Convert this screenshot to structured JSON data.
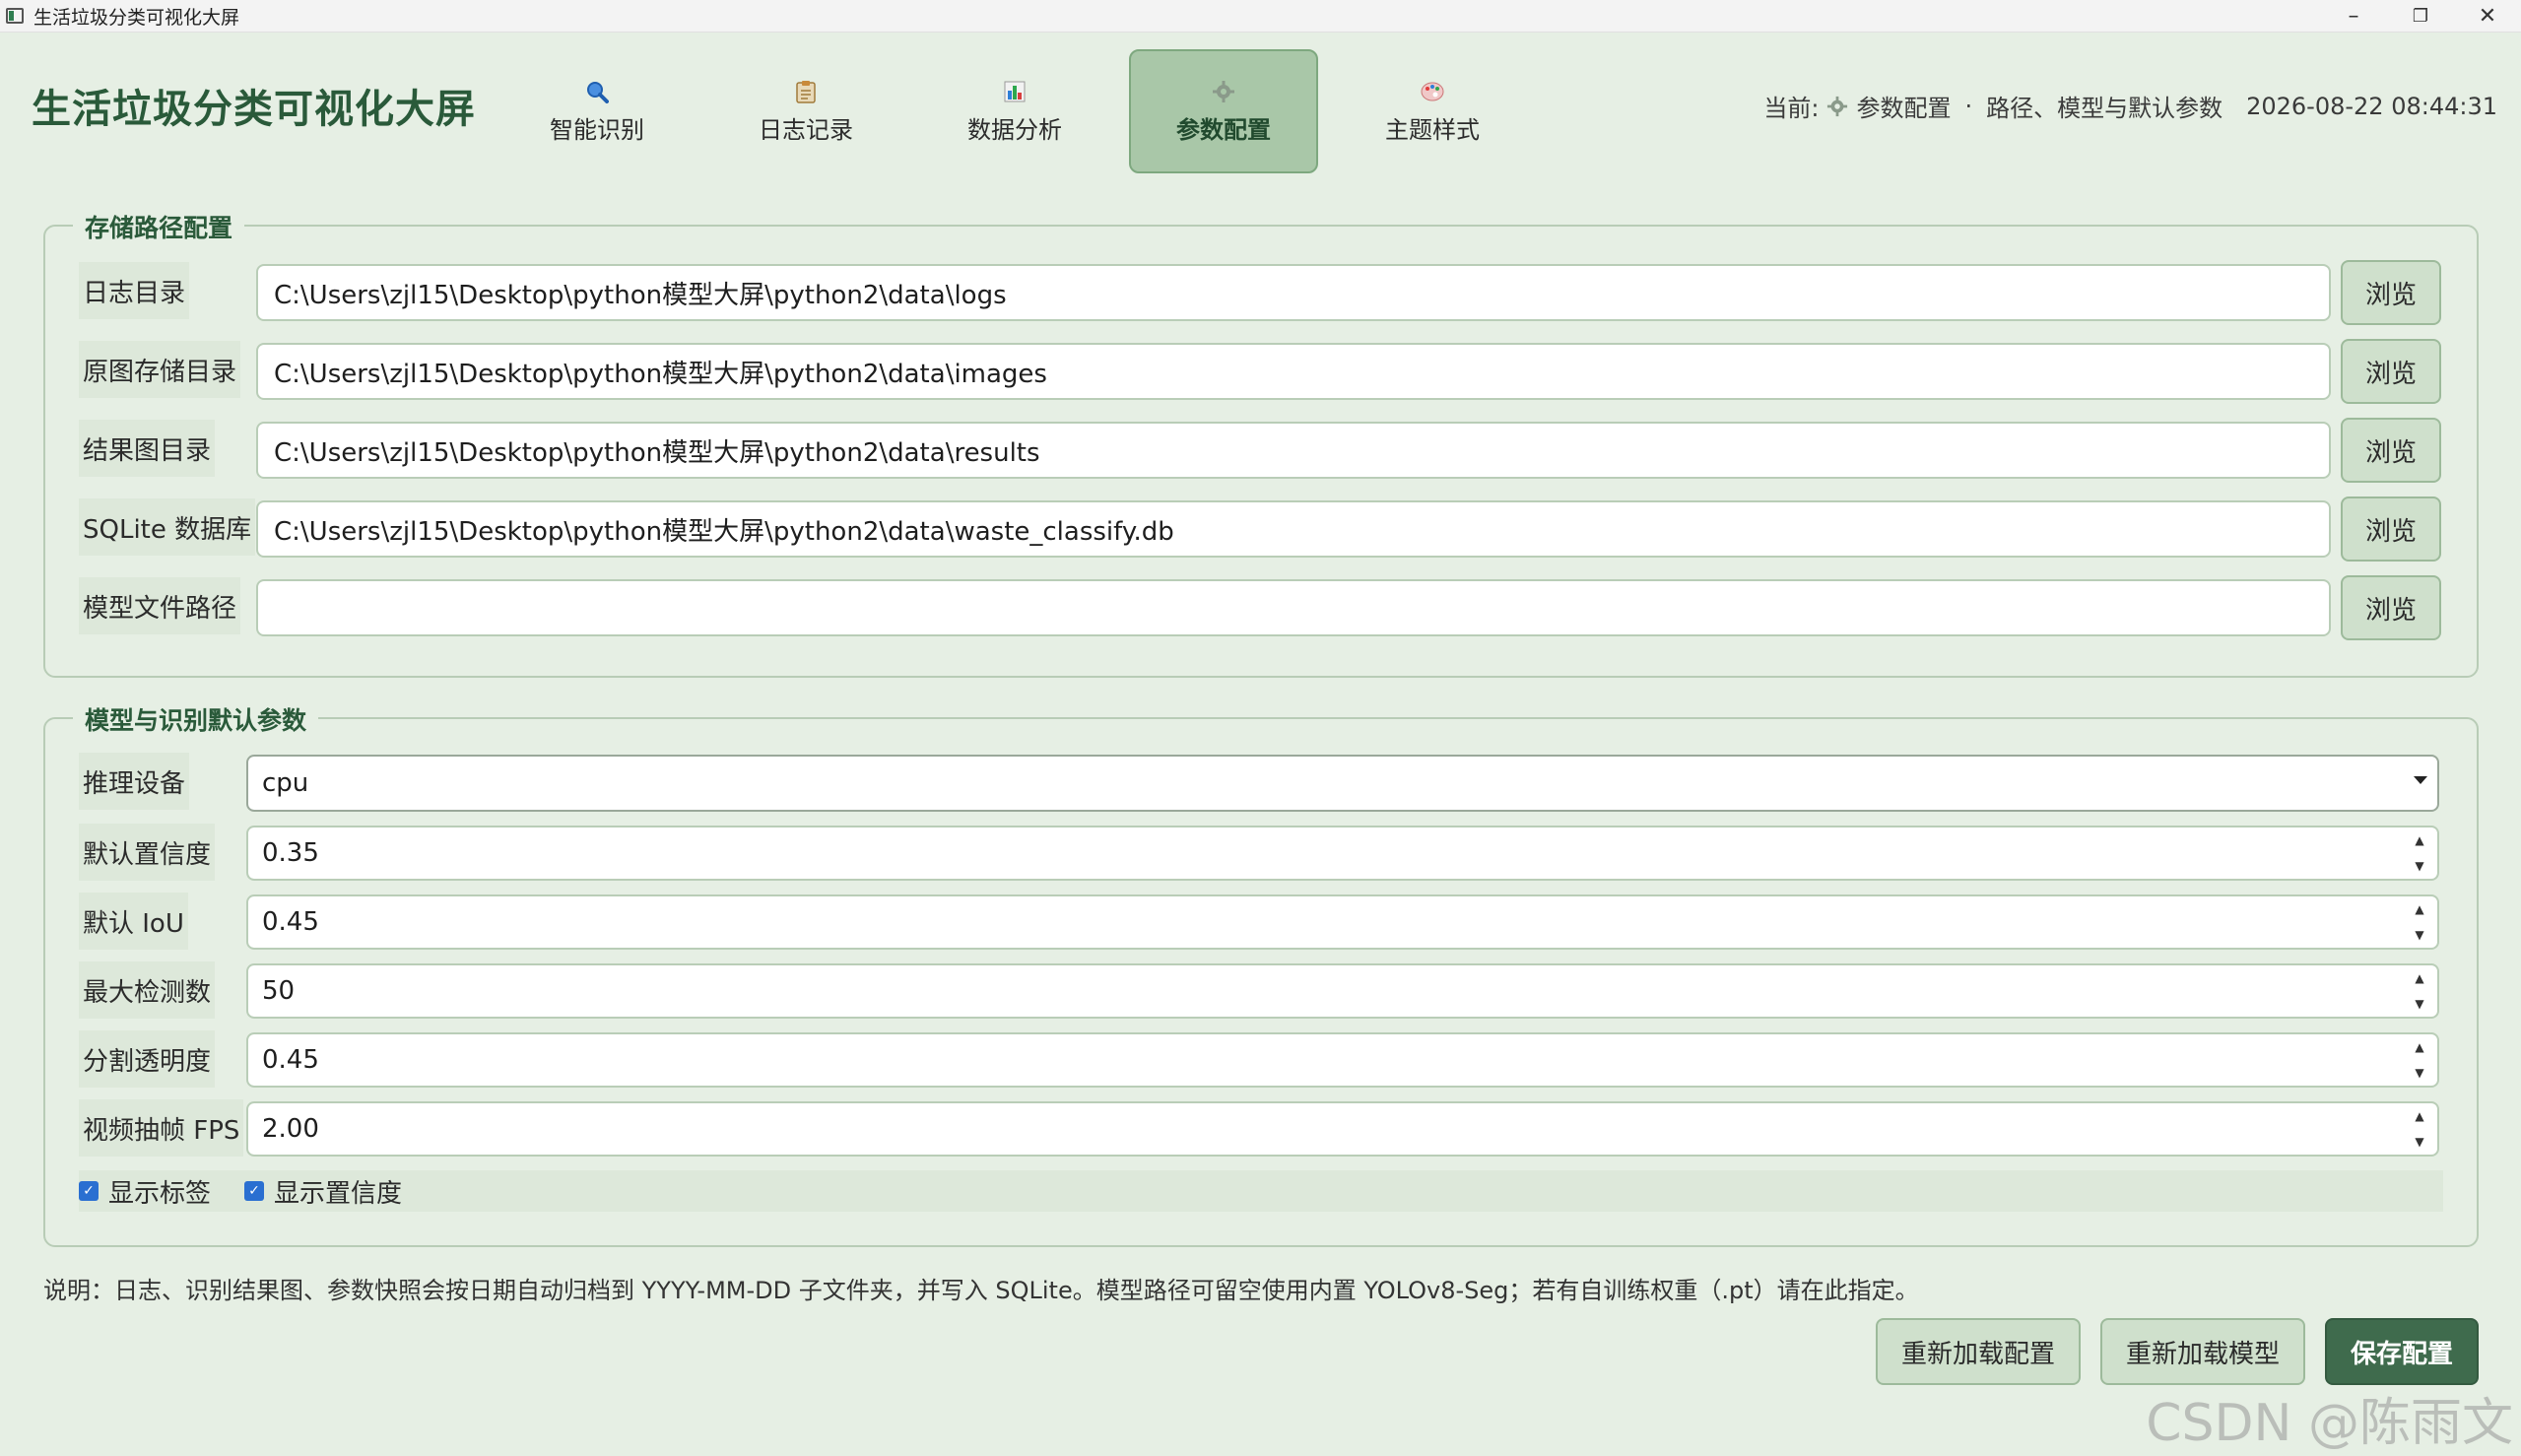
{
  "window": {
    "title": "生活垃圾分类可视化大屏",
    "minimize": "–",
    "restore": "❐",
    "close": "✕"
  },
  "header": {
    "app_title": "生活垃圾分类可视化大屏",
    "tabs": [
      {
        "label": "智能识别",
        "icon": "magnifier-icon"
      },
      {
        "label": "日志记录",
        "icon": "clipboard-icon"
      },
      {
        "label": "数据分析",
        "icon": "bar-chart-icon"
      },
      {
        "label": "参数配置",
        "icon": "gear-icon",
        "active": true
      },
      {
        "label": "主题样式",
        "icon": "palette-icon"
      }
    ],
    "status": {
      "prefix": "当前:",
      "page": "参数配置",
      "separator": "·",
      "description": "路径、模型与默认参数",
      "datetime": "2026-08-22 08:44:31"
    }
  },
  "storage": {
    "title": "存储路径配置",
    "browse_label": "浏览",
    "rows": [
      {
        "label": "日志目录",
        "value": "C:\\Users\\zjl15\\Desktop\\python模型大屏\\python2\\data\\logs"
      },
      {
        "label": "原图存储目录",
        "value": "C:\\Users\\zjl15\\Desktop\\python模型大屏\\python2\\data\\images"
      },
      {
        "label": "结果图目录",
        "value": "C:\\Users\\zjl15\\Desktop\\python模型大屏\\python2\\data\\results"
      },
      {
        "label": "SQLite 数据库",
        "value": "C:\\Users\\zjl15\\Desktop\\python模型大屏\\python2\\data\\waste_classify.db"
      },
      {
        "label": "模型文件路径",
        "value": ""
      }
    ]
  },
  "model": {
    "title": "模型与识别默认参数",
    "device": {
      "label": "推理设备",
      "value": "cpu"
    },
    "fields": [
      {
        "label": "默认置信度",
        "value": "0.35"
      },
      {
        "label": "默认 IoU",
        "value": "0.45"
      },
      {
        "label": "最大检测数",
        "value": "50"
      },
      {
        "label": "分割透明度",
        "value": "0.45"
      },
      {
        "label": "视频抽帧 FPS",
        "value": "2.00"
      }
    ],
    "checkboxes": [
      {
        "label": "显示标签",
        "checked": true
      },
      {
        "label": "显示置信度",
        "checked": true
      }
    ]
  },
  "note": "说明：日志、识别结果图、参数快照会按日期自动归档到 YYYY-MM-DD 子文件夹，并写入 SQLite。模型路径可留空使用内置 YOLOv8-Seg；若有自训练权重（.pt）请在此指定。",
  "actions": {
    "reload_config": "重新加载配置",
    "reload_model": "重新加载模型",
    "save_config": "保存配置"
  },
  "watermark": "CSDN @陈雨文",
  "colors": {
    "background": "#e6efe4",
    "accent": "#3f6b4d",
    "active_tab": "#a9c7a8",
    "title_green": "#2a5a3a"
  }
}
